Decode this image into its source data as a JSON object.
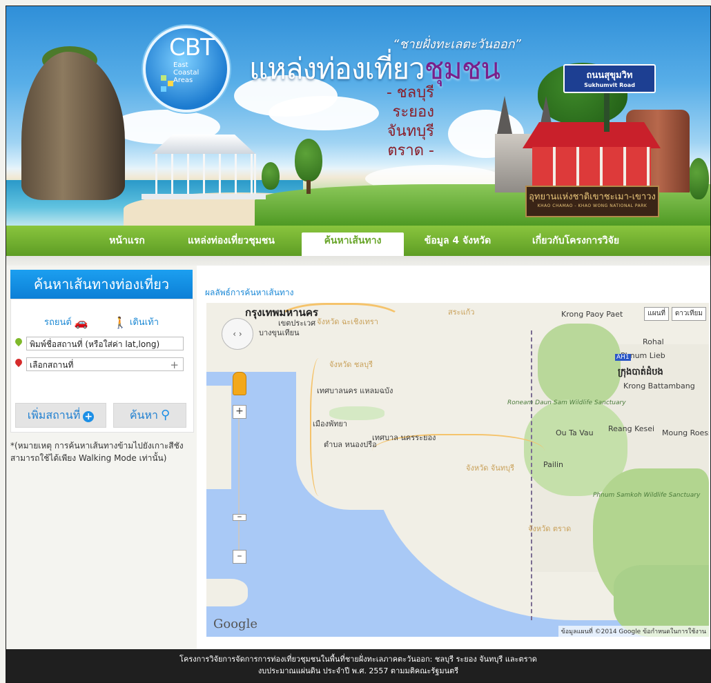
{
  "banner": {
    "logo_big": "CBT",
    "logo_small": "East Coastal Areas",
    "tagline": "“ชายฝั่งทะเลตะวันออก”",
    "title_main": "แหล่งท่องเที่ยว",
    "title_accent": "ชุมชน",
    "provinces": [
      "- ชลบุรี",
      "ระยอง",
      "จันทบุรี",
      "ตราด -"
    ],
    "road_sign": "ถนนสุขุมวิท",
    "road_sign_en": "Sukhumvit Road",
    "park_sign": "อุทยานแห่งชาติเขาชะเมา-เขาวง",
    "park_sign_en": "KHAO CHAMAO - KHAO WONG  NATIONAL PARK"
  },
  "nav": {
    "items": [
      {
        "label": "หน้าแรก",
        "active": false
      },
      {
        "label": "แหล่งท่องเที่ยวชุมชน",
        "active": false
      },
      {
        "label": "ค้นหาเส้นทาง",
        "active": true
      },
      {
        "label": "ข้อมูล 4 จังหวัด",
        "active": false
      },
      {
        "label": "เกี่ยวกับโครงการวิจัย",
        "active": false
      }
    ]
  },
  "sidebar": {
    "heading": "ค้นหาเส้นทางท่องเที่ยว",
    "mode_car": "รถยนต์",
    "mode_walk": "เดินเท้า",
    "origin_value": "พิมพ์ชื่อสถานที่ (หรือใส่ค่า lat,long)",
    "destination_value": "เลือกสถานที่",
    "add_place_label": "เพิ่มสถานที่",
    "search_label": "ค้นหา",
    "note": "*(หมายเหตุ การค้นหาเส้นทางข้ามไปยังเกาะสีชังสามารถใช้ได้เพียง Walking Mode เท่านั้น)"
  },
  "content": {
    "result_title": "ผลลัพธ์การค้นหาเส้นทาง",
    "map": {
      "type_map": "แผนที่",
      "type_satellite": "ดาวเทียม",
      "labels": {
        "bangkok": "กรุงเทพมหานคร",
        "bangkhunthian": "บางขุนเทียน",
        "prawet": "เขตประเวศ",
        "chachoengsao": "จังหวัด ฉะเชิงเทรา",
        "chonburi_prov": "จังหวัด ชลบุรี",
        "laemchabang": "เทศบาลนคร แหลมฉบัง",
        "pattaya": "เมืองพัทยา",
        "nongprue": "ตำบล หนองปรือ",
        "rayong": "เทศบาล นครระยอง",
        "chanthaburi_prov": "จังหวัด จันทบุรี",
        "trat_prov": "จังหวัด ตราด",
        "sakaeo": "สระแก้ว",
        "krong_paoypaet": "Krong Paoy Paet",
        "phnom_lieb": "Phnum Lieb",
        "battambang_kh": "ក្រុងបាត់ដំបង",
        "battambang": "Krong Battambang",
        "roneam": "Roneam Daun Sam Wildlife Sanctuary",
        "otavau": "Ou Ta Vau",
        "reang_kesei": "Reang Kesei",
        "moung": "Moung Roessei",
        "pailin": "Pailin",
        "samkos": "Phnum Samkoh Wildlife Sanctuary",
        "ah1": "AH1",
        "rohal": "Rohal"
      },
      "google": "Google",
      "footer": "ข้อมูลแผนที่ ©2014 Google    ข้อกำหนดในการใช้งาน"
    }
  },
  "footer": {
    "line1": "โครงการวิจัยการจัดการการท่องเที่ยวชุมชนในพื้นที่ชายฝั่งทะเลภาคตะวันออก: ชลบุรี ระยอง จันทบุรี และตราด",
    "line2": "งบประมาณแผ่นดิน ประจำปี พ.ศ. 2557 ตามมติคณะรัฐมนตรี"
  },
  "colors": {
    "nav_green": "#6aa62c",
    "accent_blue": "#1a88d6",
    "footer_bg": "#1f1f1f"
  }
}
